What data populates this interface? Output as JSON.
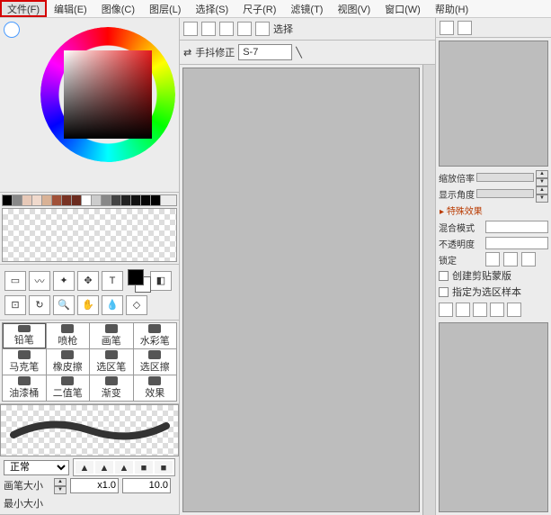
{
  "menu": {
    "file": "文件(F)",
    "edit": "编辑(E)",
    "image": "图像(C)",
    "layer": "图层(L)",
    "select": "选择(S)",
    "ruler": "尺子(R)",
    "filter": "滤镜(T)",
    "view": "视图(V)",
    "window": "窗口(W)",
    "help": "帮助(H)"
  },
  "swatches": [
    "#000000",
    "#888888",
    "#e7c9b8",
    "#f0d9cc",
    "#d9b296",
    "#a15139",
    "#783223",
    "#6b2b1f",
    "#ffffff",
    "#cccccc",
    "#888888",
    "#444444",
    "#222222",
    "#111111",
    "#060606",
    "#000000"
  ],
  "tool_icons": [
    "select-rect-icon",
    "lasso-icon",
    "magic-wand-icon",
    "move-icon",
    "text-icon",
    "crop-icon",
    "rotate-icon",
    "zoom-icon",
    "hand-icon",
    "eyedropper-icon",
    "shape-icon"
  ],
  "brushes": [
    {
      "label": "铅笔",
      "sel": true
    },
    {
      "label": "喷枪"
    },
    {
      "label": "画笔"
    },
    {
      "label": "水彩笔"
    },
    {
      "label": "马克笔"
    },
    {
      "label": "橡皮擦"
    },
    {
      "label": "选区笔"
    },
    {
      "label": "选区擦"
    },
    {
      "label": "油漆桶"
    },
    {
      "label": "二值笔"
    },
    {
      "label": "渐变"
    },
    {
      "label": "效果"
    }
  ],
  "brush_curves": [
    "▲",
    "▲",
    "▲",
    "■",
    "■"
  ],
  "brush_props": {
    "mode_label": "正常",
    "size_label": "画笔大小",
    "size_mult": "x1.0",
    "size_val": "10.0",
    "min_label": "最小大小"
  },
  "mid_top": {
    "select_label": "选择",
    "stabilizer_label": "手抖修正",
    "stabilizer_value": "S-7"
  },
  "right": {
    "zoom_label": "缩放倍率",
    "angle_label": "显示角度",
    "effects_link": "特殊效果",
    "blend_label": "混合模式",
    "opacity_label": "不透明度",
    "lock_label": "锁定",
    "clipping_label": "创建剪贴蒙版",
    "assign_sel_label": "指定为选区样本"
  }
}
